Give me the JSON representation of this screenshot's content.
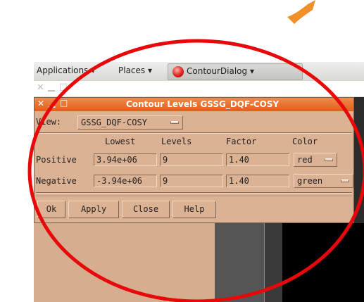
{
  "panel": {
    "applications_label": "Applications ▾",
    "places_label": "Places ▾",
    "task_label": "ContourDialog ▾"
  },
  "dialog": {
    "title": "Contour Levels GSSG_DQF-COSY",
    "view_label": "View:",
    "view_value": "GSSG_DQF-COSY",
    "columns": {
      "lowest": "Lowest",
      "levels": "Levels",
      "factor": "Factor",
      "color": "Color"
    },
    "positive": {
      "label": "Positive",
      "lowest": "3.94e+06",
      "levels": "9",
      "factor": "1.40",
      "color": "red"
    },
    "negative": {
      "label": "Negative",
      "lowest": "-3.94e+06",
      "levels": "9",
      "factor": "1.40",
      "color": "green"
    },
    "buttons": {
      "ok": "Ok",
      "apply": "Apply",
      "close": "Close",
      "help": "Help"
    }
  },
  "colors": {
    "annotation_circle": "#e8080a",
    "arrow": "#f0902a",
    "dialog_titlebar": "#e87332",
    "dialog_bg": "#dcb294"
  },
  "window_controls": {
    "close_glyph": "✕",
    "minimize_glyph": "▁",
    "maximize_glyph": "□"
  }
}
